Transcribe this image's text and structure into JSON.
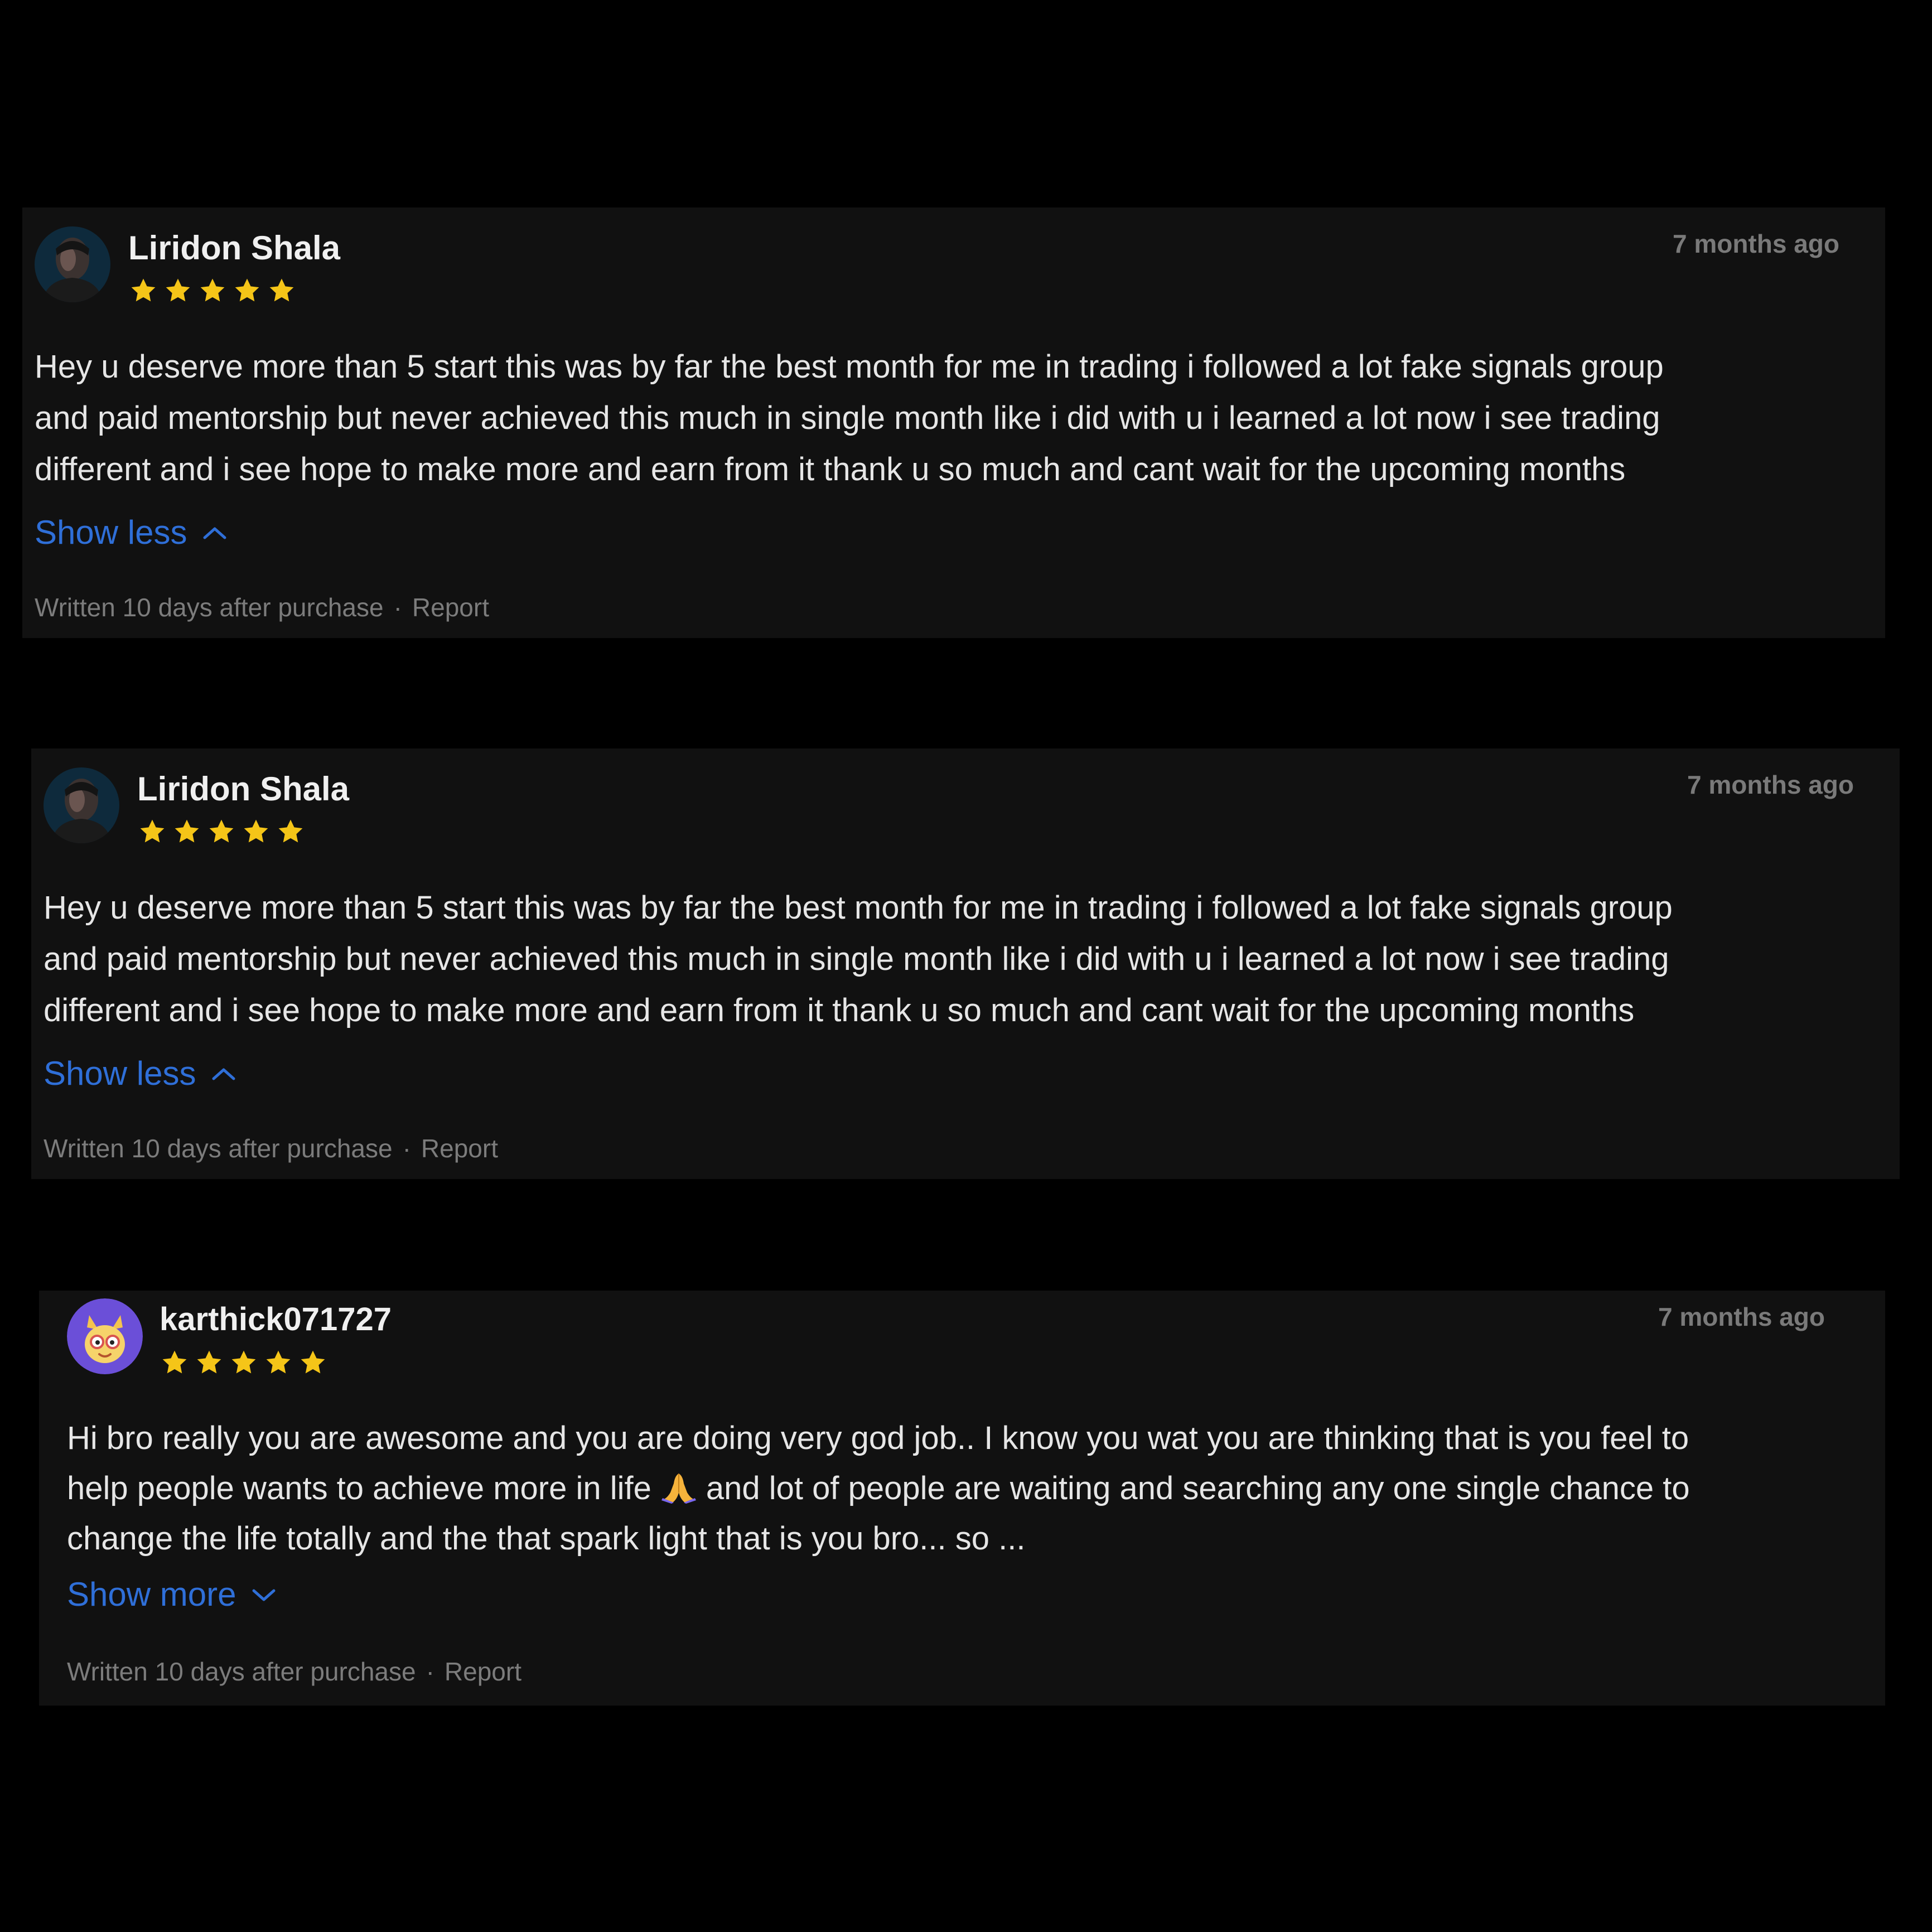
{
  "colors": {
    "background": "#000000",
    "card": "#111111",
    "link": "#2f6fd8",
    "star": "#f5c518",
    "muted": "#7a7a7a"
  },
  "reviews": [
    {
      "name": "Liridon Shala",
      "rating": 5,
      "date": "7 months ago",
      "avatar_icon": "person-photo-avatar",
      "text": "Hey u deserve more than 5 start this was by far the best month for me in trading i followed a lot fake signals group\nand paid mentorship but never achieved this much in single month like i did with u i learned a lot now i see trading\ndifferent and i see hope to make more and earn from it thank u so much and cant wait for the upcoming months",
      "toggle_label": "Show less",
      "toggle_icon": "chevron-up-icon",
      "written": "Written 10 days after purchase",
      "separator": "·",
      "report": "Report"
    },
    {
      "name": "Liridon Shala",
      "rating": 5,
      "date": "7 months ago",
      "avatar_icon": "person-photo-avatar",
      "text": "Hey u deserve more than 5 start this was by far the best month for me in trading i followed a lot fake signals group\nand paid mentorship but never achieved this much in single month like i did with u i learned a lot now i see trading\ndifferent and i see hope to make more and earn from it thank u so much and cant wait for the upcoming months",
      "toggle_label": "Show less",
      "toggle_icon": "chevron-up-icon",
      "written": "Written 10 days after purchase",
      "separator": "·",
      "report": "Report"
    },
    {
      "name": "karthick071727",
      "rating": 5,
      "date": "7 months ago",
      "avatar_icon": "cartoon-mascot-avatar",
      "text_before_emoji": "Hi bro really you are awesome and you are doing very god job.. I know you wat you are thinking that is you feel to\nhelp people wants to achieve more in life",
      "emoji_icon": "folded-hands-icon",
      "text_after_emoji": "and lot of people are waiting and searching any one single chance to\nchange the life totally and the that spark light that is you bro... so ...",
      "toggle_label": "Show more",
      "toggle_icon": "chevron-down-icon",
      "written": "Written 10 days after purchase",
      "separator": "·",
      "report": "Report"
    }
  ]
}
